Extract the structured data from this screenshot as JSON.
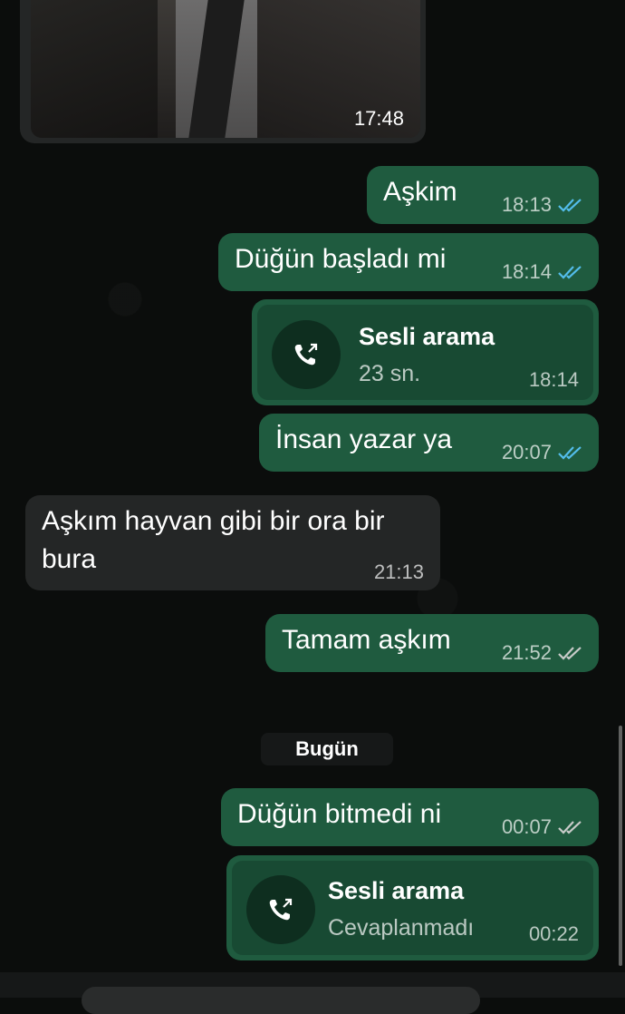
{
  "photo_message": {
    "time": "17:48"
  },
  "messages": [
    {
      "text": "Aşkim",
      "time": "18:13",
      "status": "read"
    },
    {
      "text": "Düğün başladı mi",
      "time": "18:14",
      "status": "read"
    },
    {
      "text": "İnsan yazar ya",
      "time": "20:07",
      "status": "read"
    },
    {
      "text_line1": "Aşkım hayvan gibi bir ora bir",
      "text_line2": "bura",
      "time": "21:13"
    },
    {
      "text": "Tamam aşkım",
      "time": "21:52",
      "status": "delivered"
    },
    {
      "text": "Düğün bitmedi ni",
      "time": "00:07",
      "status": "delivered"
    }
  ],
  "calls": [
    {
      "title": "Sesli arama",
      "subtitle": "23 sn.",
      "time": "18:14",
      "icon": "outgoing-call-icon"
    },
    {
      "title": "Sesli arama",
      "subtitle": "Cevaplanmadı",
      "time": "00:22",
      "icon": "outgoing-call-icon"
    }
  ],
  "date_separator": "Bugün",
  "colors": {
    "outgoing": "#1f5b3f",
    "incoming": "#242626",
    "read_tick": "#53bdeb",
    "delivered_tick": "#c8cbc9"
  }
}
